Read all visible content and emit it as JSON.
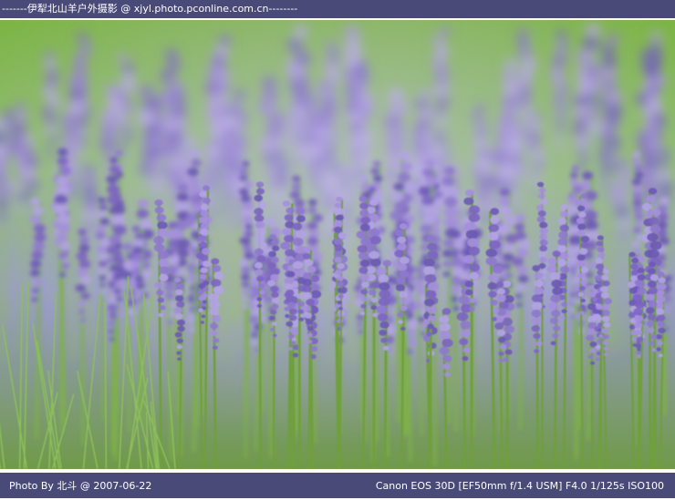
{
  "header": {
    "watermark": "-------伊犁北山羊户外摄影 @ xjyl.photo.pconline.com.cn--------"
  },
  "photo": {
    "subject": "lavender field",
    "colors": {
      "background_green": "#6aa63a",
      "flower_purple": "#9b7fd6",
      "flower_dark": "#6a52b0",
      "stem_green": "#7fb04a"
    }
  },
  "footer": {
    "credit": "Photo By 北斗  @  2007-06-22",
    "exif": "Canon EOS 30D [EF50mm f/1.4 USM] F4.0 1/125s ISO100"
  }
}
